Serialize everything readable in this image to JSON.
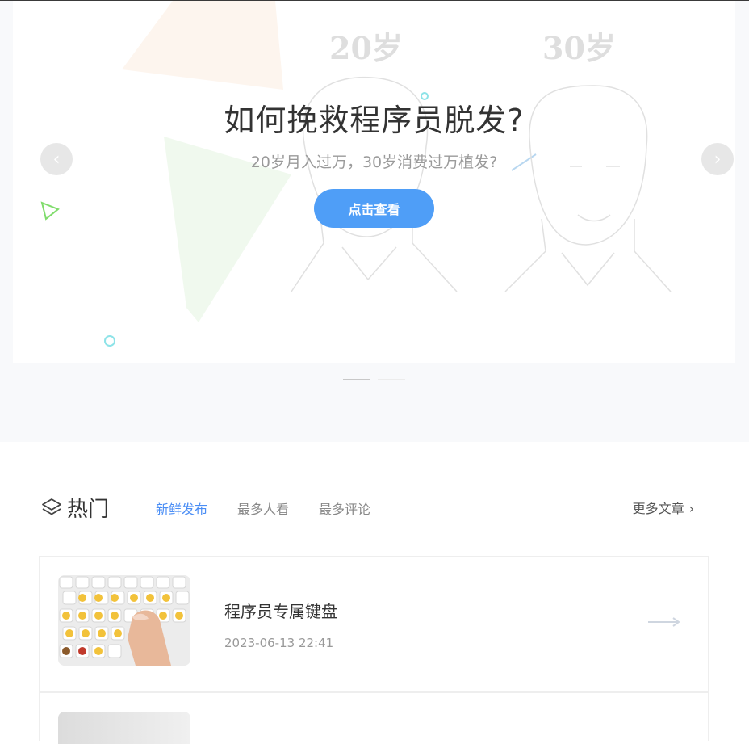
{
  "banner": {
    "age_left": "20岁",
    "age_right": "30岁",
    "title": "如何挽救程序员脱发?",
    "subtitle": "20岁月入过万，30岁消费过万植发?",
    "button_label": "点击查看",
    "prev_symbol": "‹",
    "next_symbol": "›",
    "slide_count": 2,
    "active_slide": 1
  },
  "hot": {
    "title": "热门",
    "tabs": [
      {
        "label": "新鲜发布",
        "active": true
      },
      {
        "label": "最多人看",
        "active": false
      },
      {
        "label": "最多评论",
        "active": false
      }
    ],
    "more_label": "更多文章",
    "more_symbol": "›"
  },
  "articles": [
    {
      "title": "程序员专属键盘",
      "date": "2023-06-13 22:41"
    }
  ],
  "colors": {
    "accent": "#4f9ef7",
    "tab_active": "#4b8ef5",
    "page_bg": "#f8f9fb"
  },
  "icons": {
    "hot": "layers-icon",
    "card_arrow": "long-arrow-right-icon",
    "thumb": "emoji-keyboard-image"
  }
}
